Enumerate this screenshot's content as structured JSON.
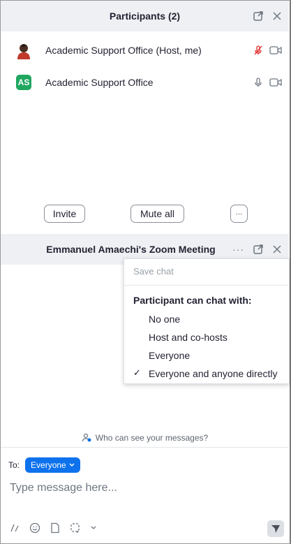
{
  "participants_panel": {
    "title": "Participants (2)",
    "participants": [
      {
        "name": "Academic Support Office (Host, me)",
        "avatar": "photo",
        "mic": "muted",
        "video": "off"
      },
      {
        "name": "Academic Support Office",
        "avatar_initials": "AS",
        "avatar_color": "#1fa760",
        "mic": "on",
        "video": "off"
      }
    ],
    "buttons": {
      "invite": "Invite",
      "mute_all": "Mute all",
      "more": "···"
    }
  },
  "chat_panel": {
    "title": "Emmanuel Amaechi's Zoom Meeting",
    "menu": {
      "save_chat": "Save chat",
      "header": "Participant can chat with:",
      "options": [
        "No one",
        "Host and co-hosts",
        "Everyone",
        "Everyone and anyone directly"
      ],
      "selected_index": 3
    },
    "who_can_see": "Who can see your messages?",
    "to_label": "To:",
    "recipient": "Everyone",
    "message_placeholder": "Type message here..."
  },
  "colors": {
    "accent": "#0e72ed",
    "header_bg": "#eef0f3",
    "muted_red": "#e02828",
    "avatar_green": "#1fa760"
  }
}
